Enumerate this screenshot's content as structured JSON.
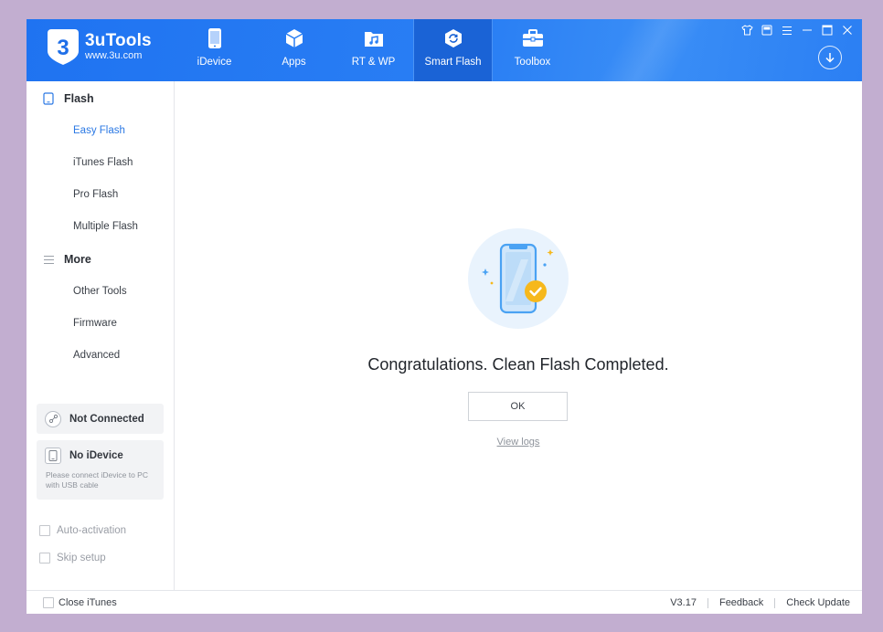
{
  "app": {
    "name": "3uTools",
    "url": "www.3u.com"
  },
  "nav": {
    "items": [
      {
        "label": "iDevice",
        "icon": "iphone-icon"
      },
      {
        "label": "Apps",
        "icon": "cube-icon"
      },
      {
        "label": "RT & WP",
        "icon": "music-folder-icon"
      },
      {
        "label": "Smart Flash",
        "icon": "refresh-box-icon",
        "active": true
      },
      {
        "label": "Toolbox",
        "icon": "toolbox-icon"
      }
    ]
  },
  "sidebar": {
    "flash_heading": "Flash",
    "flash_items": [
      "Easy Flash",
      "iTunes Flash",
      "Pro Flash",
      "Multiple Flash"
    ],
    "more_heading": "More",
    "more_items": [
      "Other Tools",
      "Firmware",
      "Advanced"
    ],
    "connection_status": "Not Connected",
    "device_status": "No iDevice",
    "device_note": "Please connect iDevice to PC with USB cable",
    "auto_activation": "Auto-activation",
    "skip_setup": "Skip setup"
  },
  "main": {
    "message": "Congratulations. Clean Flash Completed.",
    "ok_label": "OK",
    "view_logs": "View logs"
  },
  "footer": {
    "close_itunes": "Close iTunes",
    "version": "V3.17",
    "feedback": "Feedback",
    "check_update": "Check Update"
  },
  "colors": {
    "header_blue": "#2a7ff4",
    "active_blue": "#2a78e4",
    "success_yellow": "#f6b81c"
  }
}
